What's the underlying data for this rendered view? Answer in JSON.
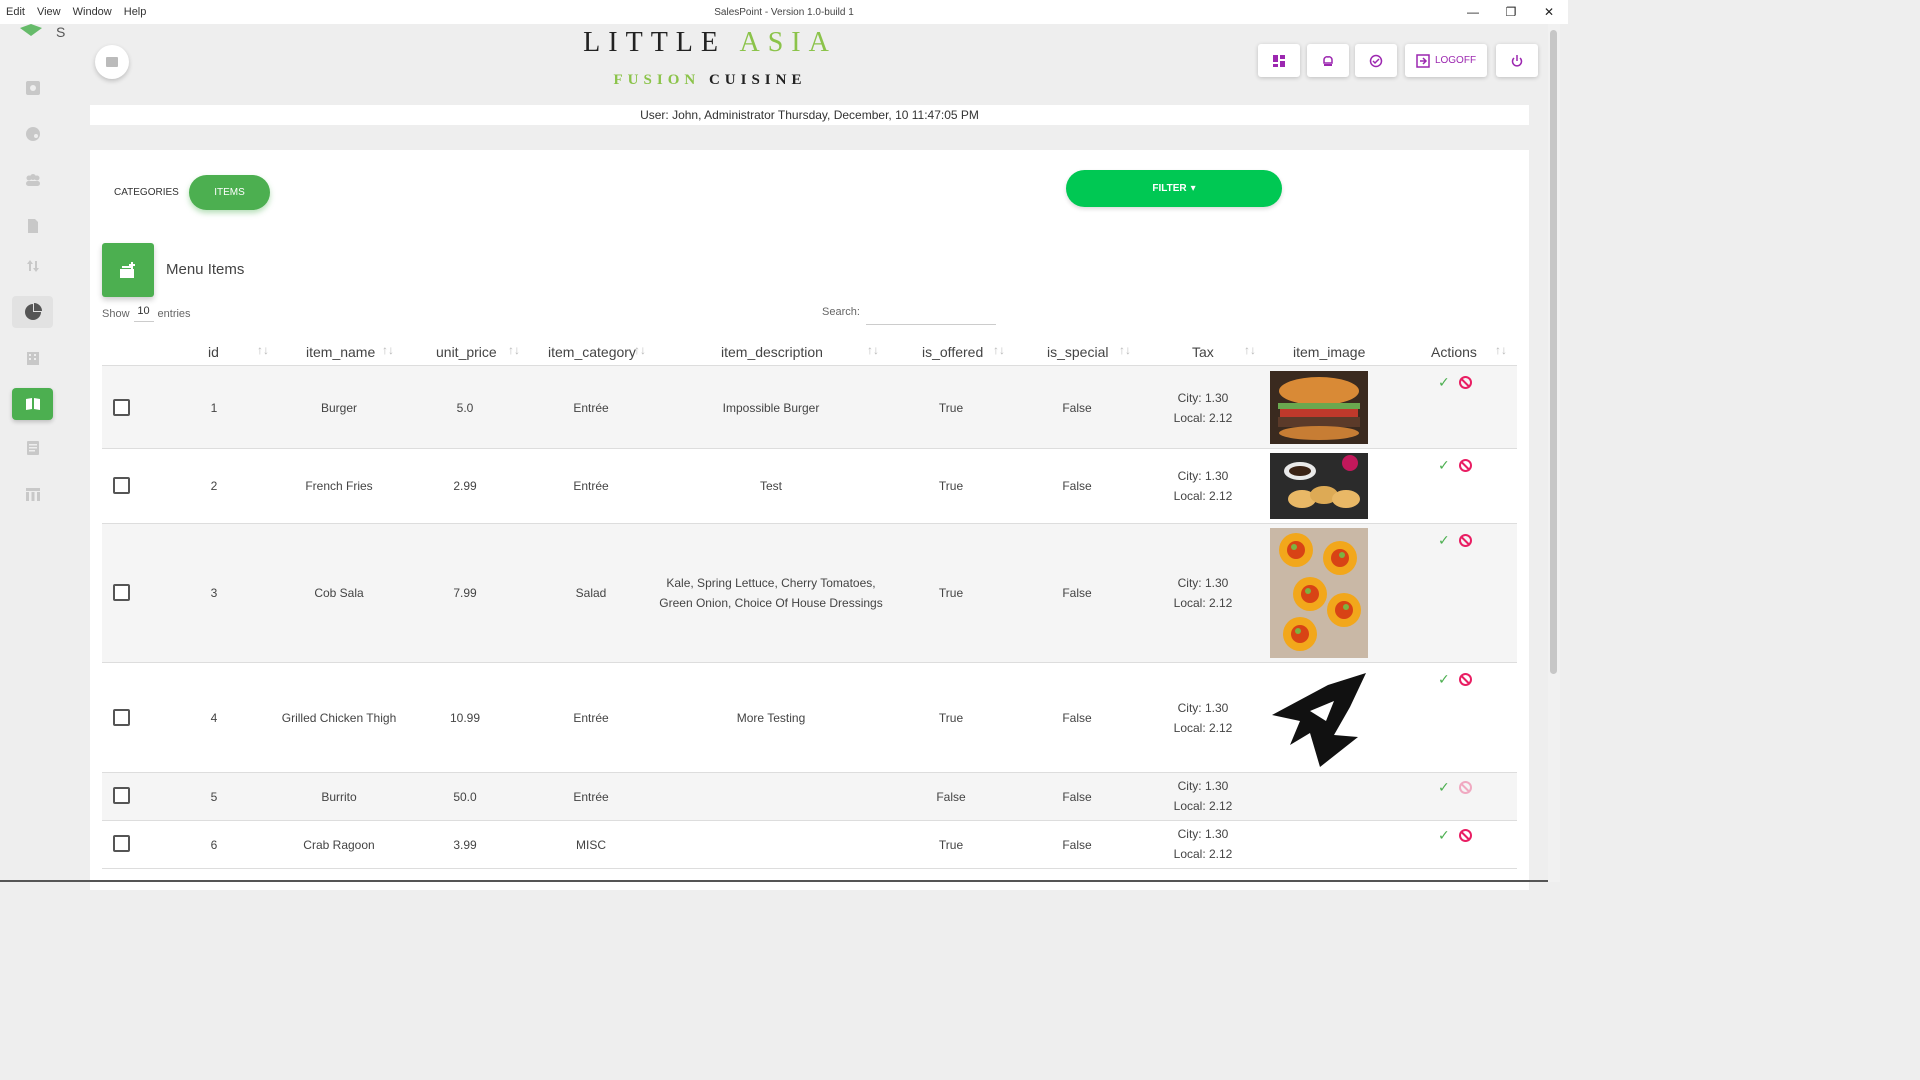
{
  "window": {
    "title": "SalesPoint - Version 1.0-build 1",
    "menu": [
      "Edit",
      "View",
      "Window",
      "Help"
    ]
  },
  "sidebar": {
    "logo_text": "S",
    "items": [
      {
        "icon": "gear-icon"
      },
      {
        "icon": "palette-icon"
      },
      {
        "icon": "users-icon"
      },
      {
        "icon": "file-icon"
      },
      {
        "icon": "sort-arrows-icon"
      },
      {
        "icon": "pie-chart-icon"
      },
      {
        "icon": "building-icon"
      },
      {
        "icon": "menu-book-icon",
        "active": true
      },
      {
        "icon": "receipt-icon"
      },
      {
        "icon": "table-icon"
      }
    ]
  },
  "brand": {
    "line1_a": "LITTLE",
    "line1_b": "ASIA",
    "line2_a": "FUSION",
    "line2_b": "CUISINE"
  },
  "toolbar": {
    "logoff_label": "LOGOFF"
  },
  "userbar": {
    "text": "User: John, Administrator Thursday, December, 10 11:47:05 PM"
  },
  "tabs": {
    "categories": "CATEGORIES",
    "items": "ITEMS"
  },
  "filter": {
    "label": "FILTER"
  },
  "section": {
    "title": "Menu Items"
  },
  "table_controls": {
    "show": "Show",
    "entries_count": "10",
    "entries": "entries",
    "search_label": "Search:"
  },
  "table": {
    "columns": [
      "id",
      "item_name",
      "unit_price",
      "item_category",
      "item_description",
      "is_offered",
      "is_special",
      "Tax",
      "item_image",
      "Actions"
    ],
    "rows": [
      {
        "id": "1",
        "item_name": "Burger",
        "unit_price": "5.0",
        "item_category": "Entrée",
        "item_description": "Impossible Burger",
        "is_offered": "True",
        "is_special": "False",
        "tax_city": "City: 1.30",
        "tax_local": "Local: 2.12",
        "image": "burger"
      },
      {
        "id": "2",
        "item_name": "French Fries",
        "unit_price": "2.99",
        "item_category": "Entrée",
        "item_description": "Test",
        "is_offered": "True",
        "is_special": "False",
        "tax_city": "City: 1.30",
        "tax_local": "Local: 2.12",
        "image": "dumplings"
      },
      {
        "id": "3",
        "item_name": "Cob Sala",
        "unit_price": "7.99",
        "item_category": "Salad",
        "item_description": "Kale, Spring Lettuce, Cherry Tomatoes, Green Onion, Choice Of House Dressings",
        "is_offered": "True",
        "is_special": "False",
        "tax_city": "City: 1.30",
        "tax_local": "Local: 2.12",
        "image": "tacos"
      },
      {
        "id": "4",
        "item_name": "Grilled Chicken Thigh",
        "unit_price": "10.99",
        "item_category": "Entrée",
        "item_description": "More Testing",
        "is_offered": "True",
        "is_special": "False",
        "tax_city": "City: 1.30",
        "tax_local": "Local: 2.12",
        "image": "eagle-logo"
      },
      {
        "id": "5",
        "item_name": "Burrito",
        "unit_price": "50.0",
        "item_category": "Entrée",
        "item_description": "",
        "is_offered": "False",
        "is_special": "False",
        "tax_city": "City: 1.30",
        "tax_local": "Local: 2.12",
        "image": ""
      },
      {
        "id": "6",
        "item_name": "Crab Ragoon",
        "unit_price": "3.99",
        "item_category": "MISC",
        "item_description": "",
        "is_offered": "True",
        "is_special": "False",
        "tax_city": "City: 1.30",
        "tax_local": "Local: 2.12",
        "image": ""
      }
    ]
  }
}
